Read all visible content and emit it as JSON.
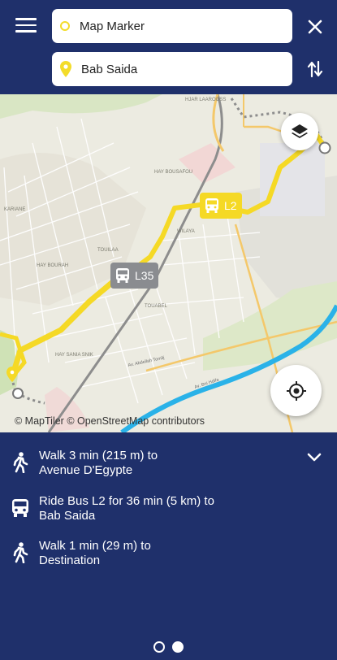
{
  "search": {
    "from_value": "Map Marker",
    "to_value": "Bab Saida"
  },
  "map": {
    "attribution": "© MapTiler © OpenStreetMap contributors",
    "bus_badges": [
      {
        "label": "L2"
      },
      {
        "label": "L35"
      }
    ],
    "map_labels": [
      "HAY BOUSAFOU",
      "HAY BOURAH",
      "TOUILAA",
      "WILAYA",
      "TOUABEL",
      "HAY SANIA SNIK",
      "KARIANE",
      "Av. Abdellah Tomilj",
      "Av. Bni Hdifa",
      "HJAR LAAROOSS"
    ]
  },
  "directions": {
    "steps": [
      {
        "icon": "walk-icon",
        "line1": "Walk 3 min (215 m) to",
        "line2": "Avenue D'Egypte"
      },
      {
        "icon": "bus-icon",
        "line1": "Ride Bus L2 for 36 min (5 km) to",
        "line2": "Bab Saida"
      },
      {
        "icon": "walk-icon",
        "line1": "Walk 1 min (29 m) to",
        "line2": "Destination"
      }
    ]
  },
  "pager": {
    "pages": 2,
    "active": 2
  },
  "colors": {
    "header_bg": "#1f306b",
    "route_yellow": "#f5d925",
    "marker_yellow": "#f3dc2a",
    "bus_gray": "#8a8c90",
    "water": "#2ab2e8"
  }
}
